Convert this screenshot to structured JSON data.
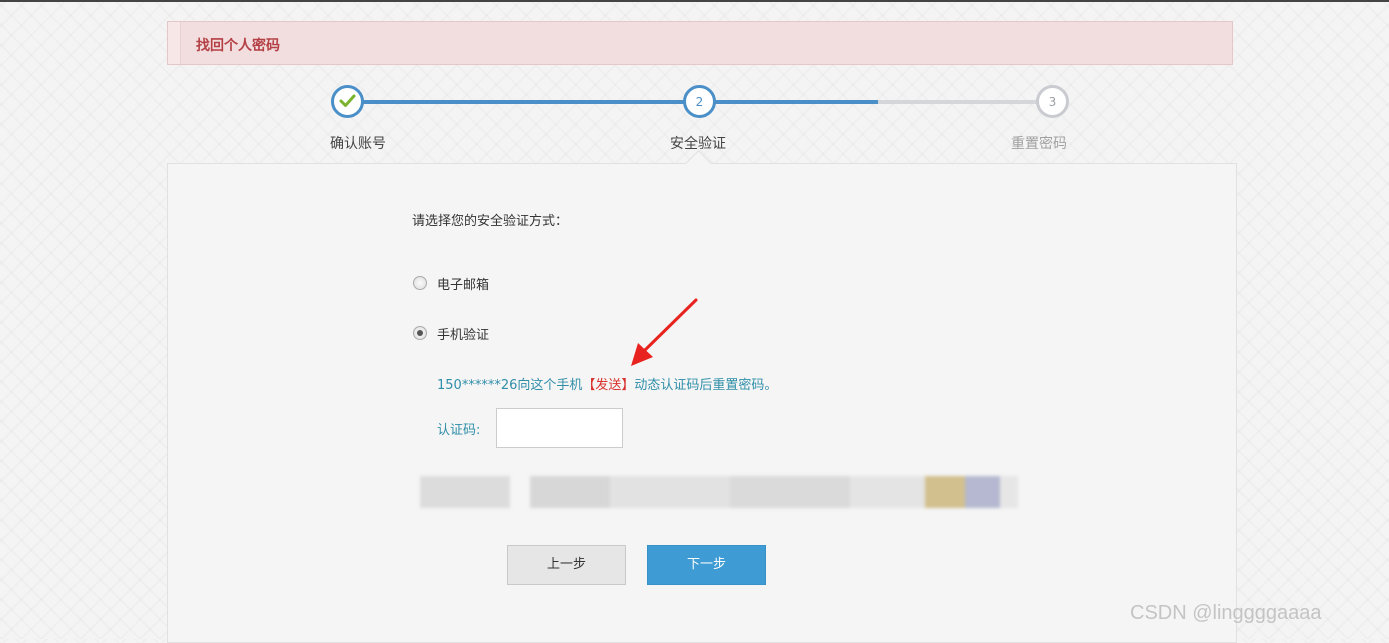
{
  "header": {
    "title": "找回个人密码"
  },
  "steps": [
    {
      "number": "1",
      "label": "确认账号",
      "state": "done"
    },
    {
      "number": "2",
      "label": "安全验证",
      "state": "current"
    },
    {
      "number": "3",
      "label": "重置密码",
      "state": "todo"
    }
  ],
  "form": {
    "prompt": "请选择您的安全验证方式：",
    "options": [
      {
        "label": "电子邮箱",
        "selected": false
      },
      {
        "label": "手机验证",
        "selected": true
      }
    ],
    "phone_info": {
      "masked_number": "150******26",
      "prefix": "向这个手机",
      "send_link": "【发送】",
      "suffix": "动态认证码后重置密码。"
    },
    "code_label": "认证码:",
    "code_value": ""
  },
  "buttons": {
    "prev": "上一步",
    "next": "下一步"
  },
  "watermark": "CSDN @linggggaaaa",
  "colors": {
    "accent_blue": "#4a8fc8",
    "link_red": "#d9322f",
    "info_teal": "#2f8ea8",
    "header_bg": "#f2dede",
    "header_text": "#b44045",
    "annotation_arrow": "#e8231f"
  }
}
